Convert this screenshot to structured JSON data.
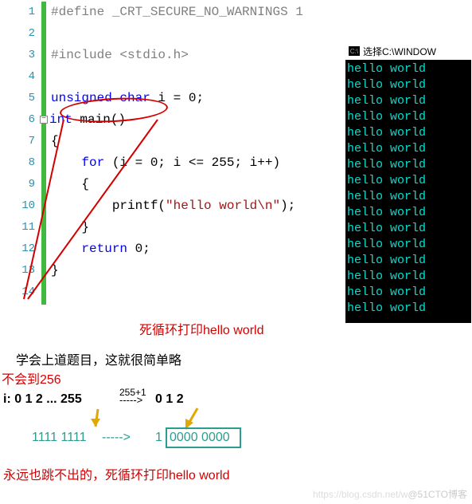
{
  "editor": {
    "lines": [
      {
        "n": "1",
        "html": "<span class='pre'>#define</span> <span class='pre'>_CRT_SECURE_NO_WARNINGS 1</span>"
      },
      {
        "n": "2",
        "html": ""
      },
      {
        "n": "3",
        "html": "<span class='inc'>#include &lt;stdio.h&gt;</span>"
      },
      {
        "n": "4",
        "html": ""
      },
      {
        "n": "5",
        "html": "<span class='kw'>unsigned</span> <span class='kw'>char</span> i = 0;"
      },
      {
        "n": "6",
        "html": "<span class='kw'>int</span> main()"
      },
      {
        "n": "7",
        "html": "{"
      },
      {
        "n": "8",
        "html": "    <span class='kw'>for</span> (i = 0; i &lt;= 255; i++)"
      },
      {
        "n": "9",
        "html": "    {"
      },
      {
        "n": "10",
        "html": "        printf(<span class='str'>\"hello world\\n\"</span>);"
      },
      {
        "n": "11",
        "html": "    }"
      },
      {
        "n": "12",
        "html": "    <span class='kw'>return</span> 0;"
      },
      {
        "n": "13",
        "html": "}"
      },
      {
        "n": "14",
        "html": ""
      }
    ]
  },
  "console": {
    "title": "选择C:\\WINDOW",
    "lines": [
      "hello world",
      "hello world",
      "hello world",
      "hello world",
      "hello world",
      "hello world",
      "hello world",
      "hello world",
      "hello world",
      "hello world",
      "hello world",
      "hello world",
      "hello world",
      "hello world",
      "hello world",
      "hello world"
    ]
  },
  "annotations": {
    "loop_label": "死循环打印hello world",
    "learn": "学会上道题目，这就很简单略",
    "not256": "不会到256",
    "seq_i": "i: 0 1 2 ... 255",
    "seq_plus": "255+1",
    "seq_arrow": "----->",
    "seq_after": "0 1 2",
    "binary_left": "1111 1111",
    "binary_dash": "----->",
    "binary_one": "1",
    "binary_right": "0000 0000",
    "conclusion": "永远也跳不出的，死循环打印hello world",
    "watermark": "@51CTO博客"
  }
}
